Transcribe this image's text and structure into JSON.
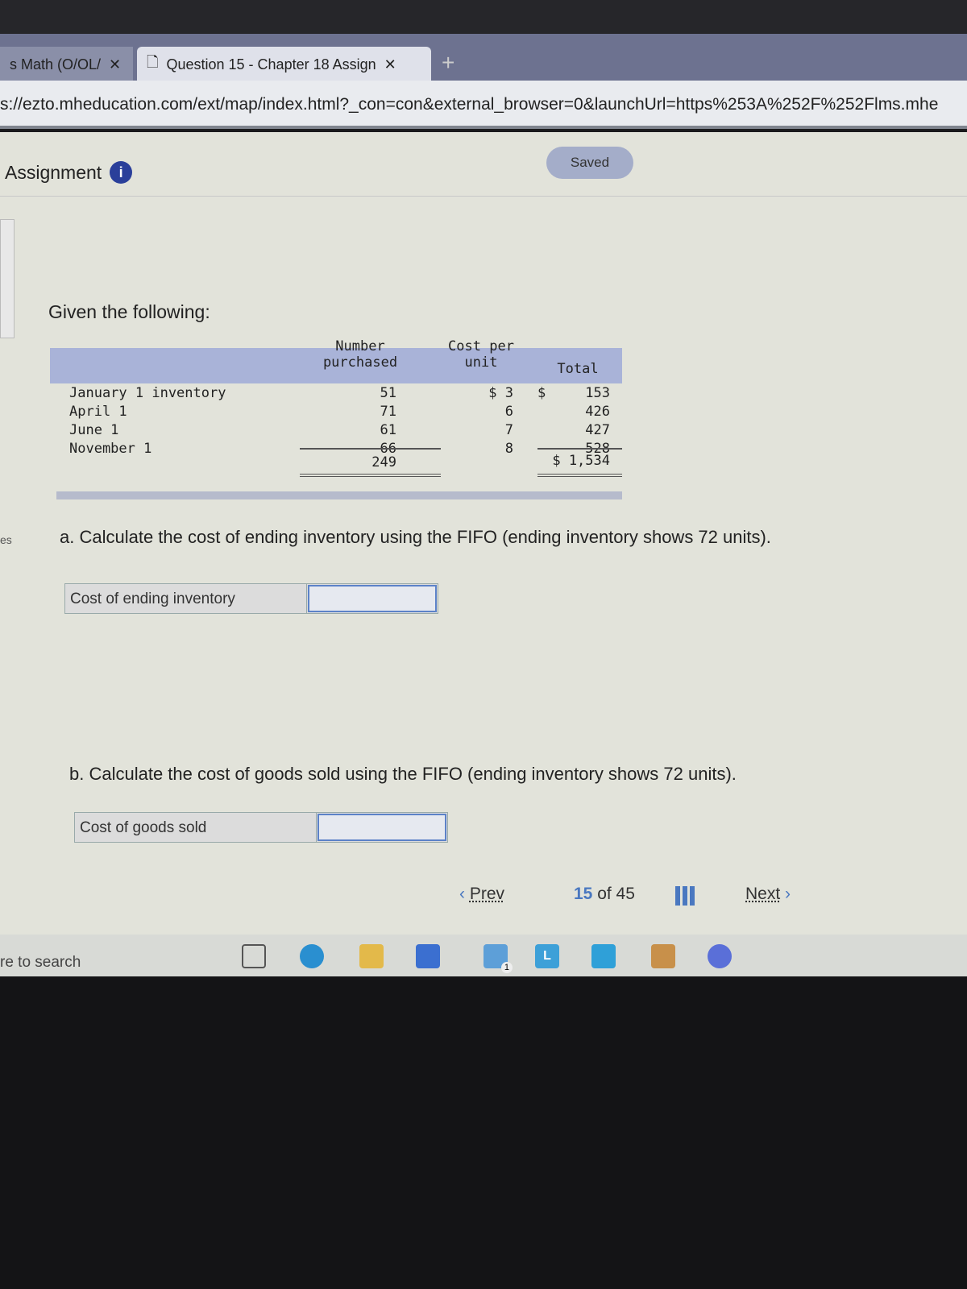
{
  "browser": {
    "tabs": [
      {
        "label": "s Math (O/OL/"
      },
      {
        "label": "Question 15 - Chapter 18 Assign"
      }
    ],
    "url": "s://ezto.mheducation.com/ext/map/index.html?_con=con&external_browser=0&launchUrl=https%253A%252F%252Flms.mhe"
  },
  "header": {
    "title": "Assignment",
    "status": "Saved"
  },
  "sidebar": {
    "label": "es"
  },
  "question": {
    "intro": "Given the following:",
    "table": {
      "headers": [
        "Number purchased",
        "Cost per unit",
        "Total"
      ],
      "rows": [
        {
          "label": "January 1 inventory",
          "number": "51",
          "cost": "$ 3",
          "total_prefix": "$",
          "total": "153"
        },
        {
          "label": "April 1",
          "number": "71",
          "cost": "6",
          "total": "426"
        },
        {
          "label": "June 1",
          "number": "61",
          "cost": "7",
          "total": "427"
        },
        {
          "label": "November 1",
          "number": "66",
          "cost": "8",
          "total": "528"
        }
      ],
      "totals": {
        "number": "249",
        "total": "$ 1,534"
      }
    },
    "part_a": {
      "text": "a. Calculate the cost of ending inventory using the FIFO (ending inventory shows 72 units).",
      "label": "Cost of ending inventory",
      "value": ""
    },
    "part_b": {
      "text": "b. Calculate the cost of goods sold using the FIFO (ending inventory shows 72 units).",
      "label": "Cost of goods sold",
      "value": ""
    }
  },
  "nav": {
    "prev": "Prev",
    "current": "15",
    "of": "of 45",
    "next": "Next"
  },
  "taskbar": {
    "search": "re to search",
    "mail_badge": "1"
  }
}
